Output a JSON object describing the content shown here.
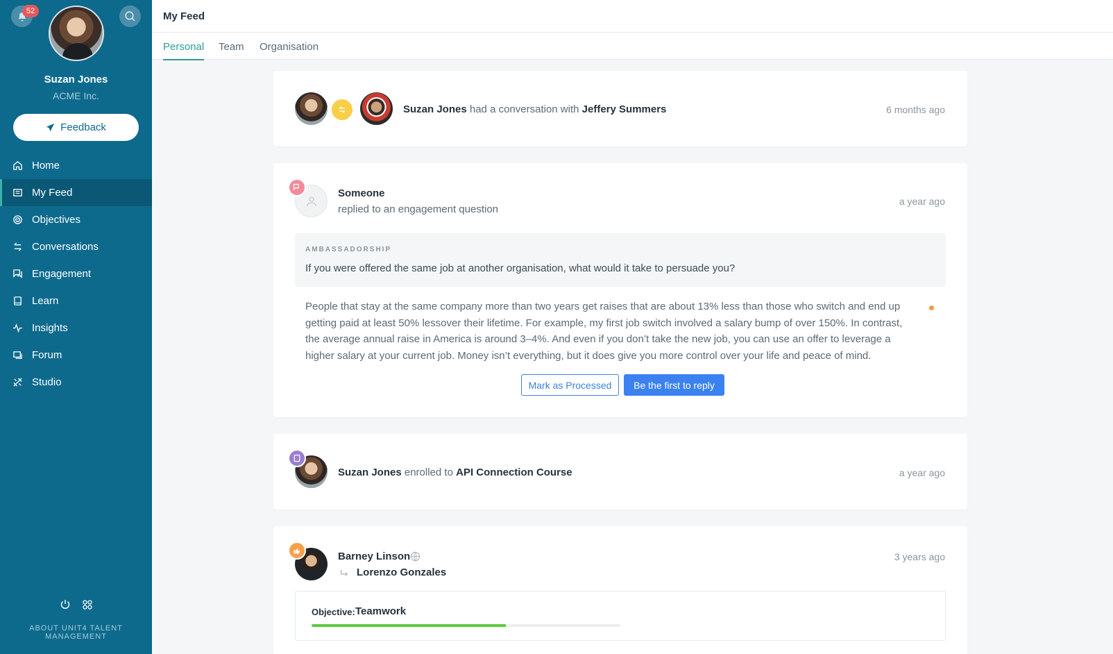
{
  "notifications": {
    "count": "52"
  },
  "profile": {
    "name": "Suzan Jones",
    "company": "ACME Inc."
  },
  "feedback_label": "Feedback",
  "nav": [
    {
      "label": "Home",
      "icon": "home-icon"
    },
    {
      "label": "My Feed",
      "icon": "feed-icon",
      "active": true
    },
    {
      "label": "Objectives",
      "icon": "target-icon"
    },
    {
      "label": "Conversations",
      "icon": "arrows-exchange-icon"
    },
    {
      "label": "Engagement",
      "icon": "chat-bubbles-icon"
    },
    {
      "label": "Learn",
      "icon": "book-icon"
    },
    {
      "label": "Insights",
      "icon": "pulse-icon"
    },
    {
      "label": "Forum",
      "icon": "forum-icon"
    },
    {
      "label": "Studio",
      "icon": "studio-icon"
    }
  ],
  "about": "ABOUT UNIT4 TALENT MANAGEMENT",
  "page_title": "My Feed",
  "tabs": [
    {
      "label": "Personal",
      "active": true
    },
    {
      "label": "Team"
    },
    {
      "label": "Organisation"
    }
  ],
  "feed": {
    "conversation": {
      "actor": "Suzan Jones",
      "verb": "had a conversation with",
      "target": "Jeffery Summers",
      "time": "6 months ago"
    },
    "engagement": {
      "actor": "Someone",
      "action": "replied to an engagement question",
      "time": "a year ago",
      "category": "AMBASSADORSHIP",
      "question": "If you were offered the same job at another organisation, what would it take to persuade you?",
      "answer": "People that stay at the same company more than two years get raises that are about 13% less than those who switch and end up getting paid at least 50% lessover their lifetime. For example, my first job switch involved a salary bump of over 150%. In contrast, the average annual raise in America is around 3–4%. And even if you don’t take the new job, you can use an offer to leverage a higher salary at your current job. Money isn’t everything, but it does give you more control over your life and peace of mind.",
      "mark_processed": "Mark as Processed",
      "reply": "Be the first to reply"
    },
    "enrollment": {
      "actor": "Suzan Jones",
      "verb": "enrolled to",
      "course": "API Connection Course",
      "time": "a year ago"
    },
    "objective": {
      "actor": "Barney Linson",
      "target": "Lorenzo Gonzales",
      "time": "3 years ago",
      "label": "Objective:",
      "name": "Teamwork",
      "progress": 0.63
    }
  },
  "colors": {
    "sidebar": "#0d6a8d",
    "accent": "#2a9d96",
    "primary_button": "#3b82f0",
    "progress": "#5ccd3f",
    "badge_conversation": "#f9cf4a",
    "badge_engagement": "#f28b9a",
    "badge_learn": "#9b7ed1",
    "badge_objective": "#f5a04a"
  }
}
